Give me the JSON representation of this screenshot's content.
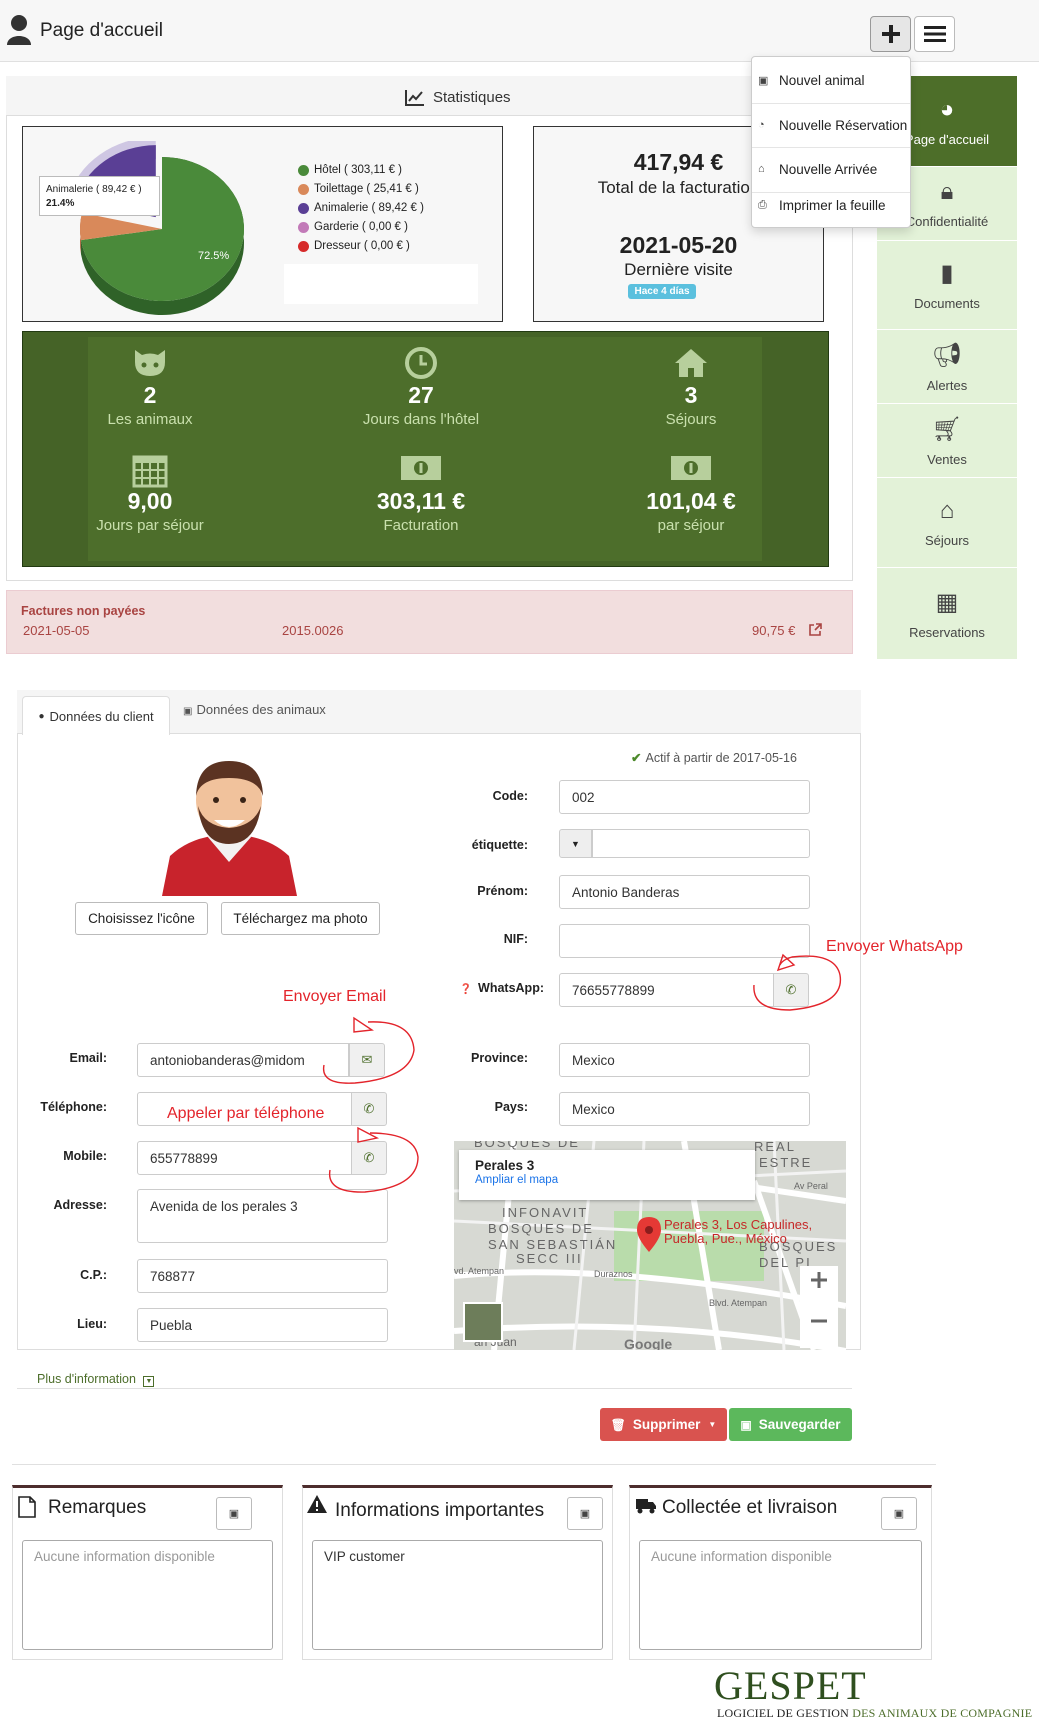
{
  "header": {
    "title": "Page d'accueil"
  },
  "dropdown": {
    "items": [
      "Nouvel animal",
      "Nouvelle Réservation",
      "Nouvelle Arrivée",
      "Imprimer la feuille"
    ]
  },
  "sidebar": {
    "items": [
      "Page d'accueil",
      "Confidentialité",
      "Documents",
      "Alertes",
      "Ventes",
      "Séjours",
      "Reservations"
    ]
  },
  "stats": {
    "title": "Statistiques",
    "legend": [
      {
        "label": "Hôtel ( 303,11 € )",
        "color": "#4a8a3a"
      },
      {
        "label": "Toilettage ( 25,41 € )",
        "color": "#d9895a"
      },
      {
        "label": "Animalerie ( 89,42 € )",
        "color": "#5a3f95"
      },
      {
        "label": "Garderie ( 0,00 € )",
        "color": "#c27ab8"
      },
      {
        "label": "Dresseur ( 0,00 € )",
        "color": "#d62a2a"
      }
    ],
    "tooltip_label": "Animalerie ( 89,42 € )",
    "tooltip_pct": "21.4%",
    "slice_label": "72.5%",
    "total_value": "417,94 €",
    "total_label": "Total de la facturation",
    "last_visit_date": "2021-05-20",
    "last_visit_label": "Dernière visite",
    "last_visit_badge": "Hace 4 días",
    "cards": [
      {
        "value": "2",
        "label": "Les animaux",
        "icon": "github-cat-icon"
      },
      {
        "value": "27",
        "label": "Jours dans l'hôtel",
        "icon": "clock-icon"
      },
      {
        "value": "3",
        "label": "Séjours",
        "icon": "home-icon"
      },
      {
        "value": "9,00",
        "label": "Jours par séjour",
        "icon": "calendar-icon"
      },
      {
        "value": "303,11 €",
        "label": "Facturation",
        "icon": "money-icon"
      },
      {
        "value": "101,04 €",
        "label": "par séjour",
        "icon": "money-icon"
      }
    ]
  },
  "chart_data": {
    "type": "pie",
    "categories": [
      "Hôtel",
      "Toilettage",
      "Animalerie",
      "Garderie",
      "Dresseur"
    ],
    "values": [
      303.11,
      25.41,
      89.42,
      0.0,
      0.0
    ]
  },
  "invoices": {
    "title": "Factures non payées",
    "row": {
      "date": "2021-05-05",
      "number": "2015.0026",
      "amount": "90,75 €"
    }
  },
  "client": {
    "tabs": [
      "Données du client",
      "Données des animaux"
    ],
    "active_since": "Actif à partir de 2017-05-16",
    "choose_icon": "Choisissez l'icône",
    "upload_photo": "Téléchargez ma photo",
    "labels": {
      "code": "Code:",
      "tag": "étiquette:",
      "firstname": "Prénom:",
      "nif": "NIF:",
      "whatsapp": "WhatsApp:",
      "province": "Province:",
      "country": "Pays:",
      "email": "Email:",
      "phone": "Téléphone:",
      "mobile": "Mobile:",
      "address": "Adresse:",
      "zip": "C.P.:",
      "city": "Lieu:"
    },
    "values": {
      "code": "002",
      "tag": "",
      "firstname": "Antonio Banderas",
      "nif": "",
      "whatsapp": "76655778899",
      "province": "Mexico",
      "country": "Mexico",
      "email": "antoniobanderas@midom",
      "phone": "",
      "mobile": "655778899",
      "address": "Avenida de los perales 3",
      "zip": "768877",
      "city": "Puebla"
    },
    "annotations": {
      "whatsapp": "Envoyer WhatsApp",
      "email": "Envoyer Email",
      "phone": "Appeler par téléphone"
    },
    "map": {
      "place": "Perales 3",
      "enlarge": "Ampliar el mapa",
      "marker_label": "Perales 3, Los Capulines, Puebla, Pue., México",
      "streets": [
        "BOSQUES DE",
        "REAL",
        "ESTRE",
        "INFONAVIT",
        "BOSQUES DE",
        "SAN SEBASTIÁN",
        "SECC III",
        "BOSQUES",
        "DEL PI",
        "Av Peral",
        "Duraznos",
        "Blvd. Atempan",
        "vd. Atempan",
        "an Juan",
        "Google"
      ]
    },
    "more_info": "Plus d'information"
  },
  "actions": {
    "delete": "Supprimer",
    "save": "Sauvegarder"
  },
  "notes": [
    {
      "title": "Remarques",
      "text": "",
      "placeholder": "Aucune information disponible"
    },
    {
      "title": "Informations importantes",
      "text": "VIP customer",
      "placeholder": ""
    },
    {
      "title": "Collectée et livraison",
      "text": "",
      "placeholder": "Aucune information disponible"
    }
  ],
  "logo": {
    "brand": "GESPET",
    "tagline_a": "LOGICIEL DE GESTION ",
    "tagline_b": "DES ANIMAUX DE COMPAGNIE"
  }
}
